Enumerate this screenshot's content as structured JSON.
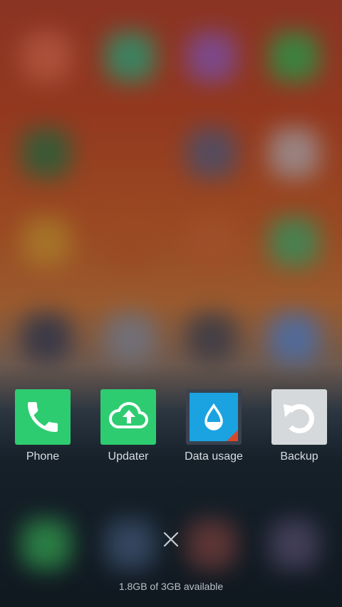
{
  "recents": {
    "apps": [
      {
        "label": "Phone",
        "icon": "phone-icon",
        "color": "#2ecc71"
      },
      {
        "label": "Updater",
        "icon": "cloud-upload-icon",
        "color": "#2ecc71"
      },
      {
        "label": "Data usage",
        "icon": "water-drop-icon",
        "color": "#1aa3e0"
      },
      {
        "label": "Backup",
        "icon": "restore-arrow-icon",
        "color": "#d6d9dc"
      }
    ]
  },
  "clear_all": {
    "icon": "close-icon"
  },
  "memory": {
    "text": "1.8GB of 3GB available"
  },
  "colors": {
    "wallpaper_top": "#8a3424",
    "wallpaper_bottom": "#101820",
    "label_text": "#d8dde2"
  }
}
